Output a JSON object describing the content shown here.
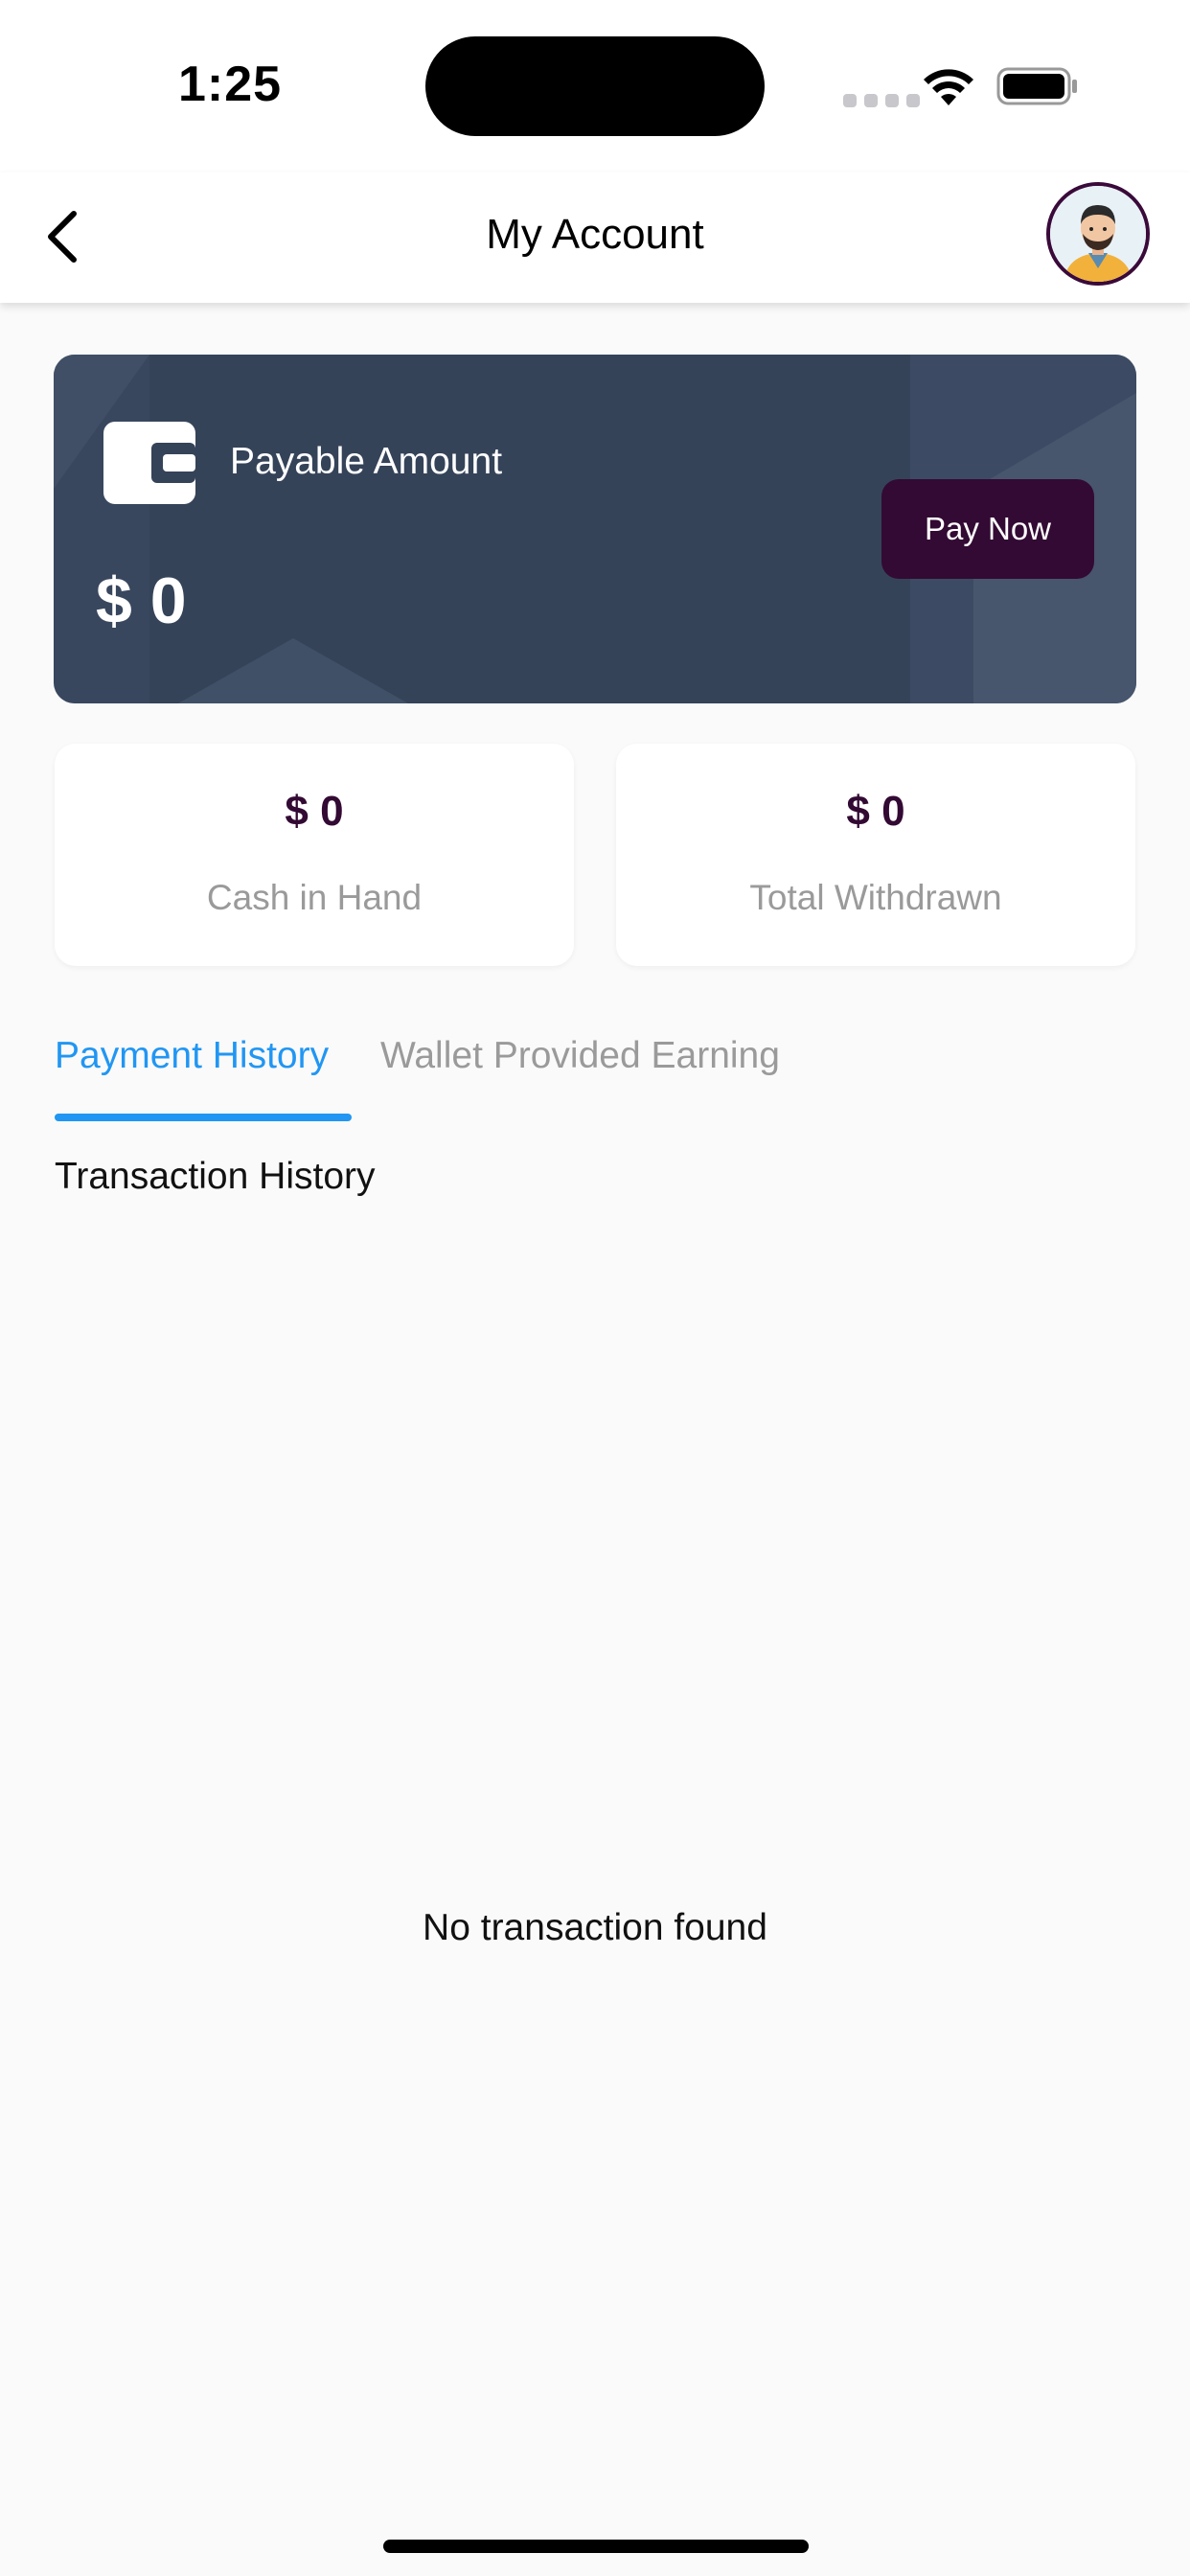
{
  "status_bar": {
    "time": "1:25"
  },
  "app_bar": {
    "title": "My Account"
  },
  "payable_card": {
    "label": "Payable Amount",
    "amount": "$ 0",
    "button_label": "Pay Now"
  },
  "stats": [
    {
      "value": "$ 0",
      "label": "Cash in Hand"
    },
    {
      "value": "$ 0",
      "label": "Total Withdrawn"
    }
  ],
  "tabs": [
    {
      "label": "Payment History",
      "active": true
    },
    {
      "label": "Wallet Provided Earning",
      "active": false
    }
  ],
  "section": {
    "title": "Transaction History"
  },
  "empty_state": {
    "message": "No transaction found"
  },
  "colors": {
    "accent": "#2196f3",
    "primary_dark": "#330a33",
    "card_bg": "#354359",
    "muted_text": "#9a9a9a",
    "page_bg": "#fafafa"
  },
  "icons": {
    "back": "chevron-left-icon",
    "wallet": "wallet-icon",
    "avatar": "user-avatar"
  }
}
